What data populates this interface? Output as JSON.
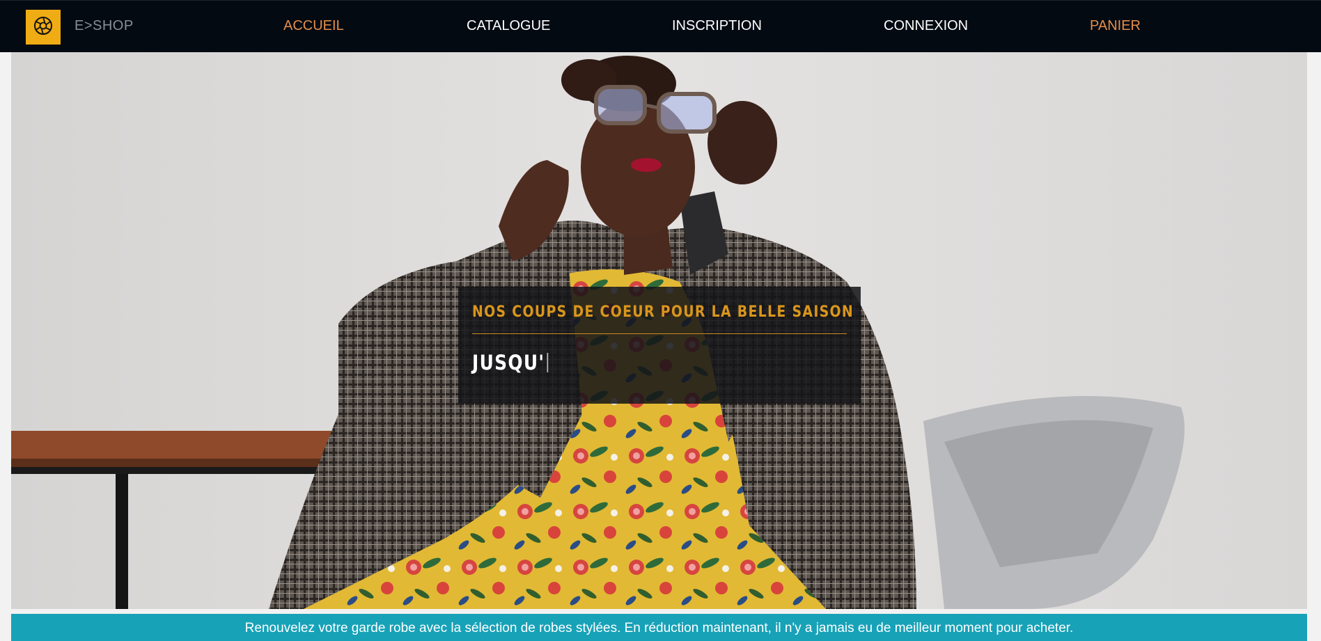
{
  "navbar": {
    "logo_icon": "aperture-icon",
    "brand": "E>SHOP",
    "items": [
      {
        "label": "ACCUEIL",
        "color": "#e58e49"
      },
      {
        "label": "CATALOGUE",
        "color": "#ffffff"
      },
      {
        "label": "INSCRIPTION",
        "color": "#ffffff"
      },
      {
        "label": "CONNEXION",
        "color": "#ffffff"
      },
      {
        "label": "PANIER",
        "color": "#e58e49"
      }
    ],
    "background": "#040a12",
    "logo_background": "#f0ac14"
  },
  "hero": {
    "promo_title": "NOS COUPS DE COEUR POUR LA BELLE SAISON",
    "promo_typed": "JUSQU'"
  },
  "banner": {
    "text": "Renouvelez votre garde robe avec la sélection de robes stylées. En réduction maintenant, il n'y a jamais eu de meilleur moment pour acheter.",
    "background": "#17a2b8"
  }
}
